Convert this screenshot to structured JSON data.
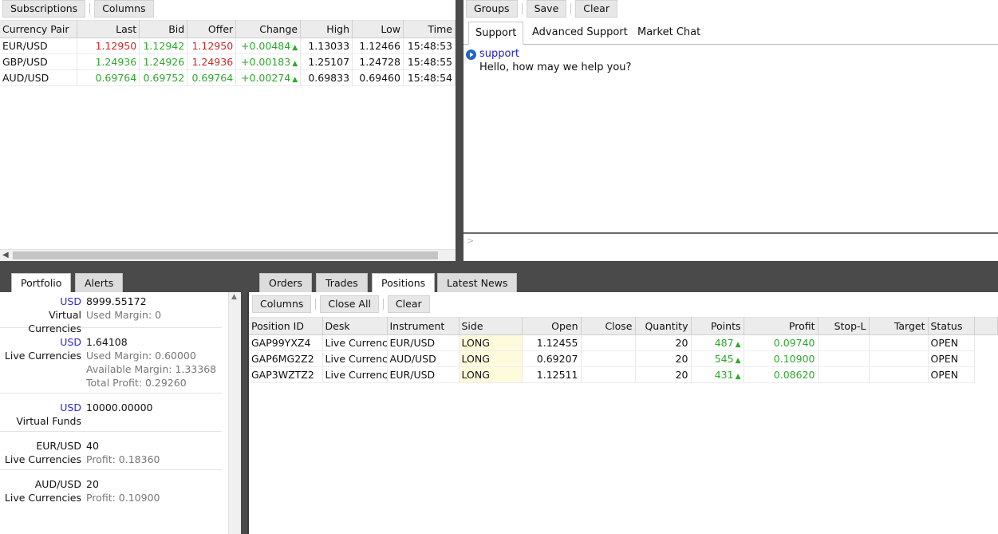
{
  "rates": {
    "toolbar": {
      "subscriptions": "Subscriptions",
      "columns": "Columns"
    },
    "headers": [
      "Currency Pair",
      "Last",
      "Bid",
      "Offer",
      "Change",
      "High",
      "Low",
      "Time"
    ],
    "rows": [
      {
        "pair": "EUR/USD",
        "last": "1.12950",
        "bid": "1.12942",
        "offer": "1.12950",
        "change": "+0.00484",
        "high": "1.13033",
        "low": "1.12466",
        "time": "15:48:53"
      },
      {
        "pair": "GBP/USD",
        "last": "1.24936",
        "bid": "1.24926",
        "offer": "1.24936",
        "change": "+0.00183",
        "high": "1.25107",
        "low": "1.24728",
        "time": "15:48:55"
      },
      {
        "pair": "AUD/USD",
        "last": "0.69764",
        "bid": "0.69752",
        "offer": "0.69764",
        "change": "+0.00274",
        "high": "0.69833",
        "low": "0.69460",
        "time": "15:48:54"
      }
    ]
  },
  "chat": {
    "toolbar": {
      "groups": "Groups",
      "save": "Save",
      "clear": "Clear"
    },
    "tabs": [
      "Support",
      "Advanced Support",
      "Market Chat"
    ],
    "message": {
      "sender": "support",
      "text": "Hello, how may we help you?"
    },
    "input_hint": ">"
  },
  "portfolio": {
    "tabs": [
      "Portfolio",
      "Alerts"
    ],
    "blocks": [
      {
        "rows": [
          {
            "label": "USD",
            "value": "8999.55172",
            "label_blue": true
          },
          {
            "label": "Virtual Currencies",
            "value": "Used Margin:  0",
            "grey": true
          }
        ]
      },
      {
        "rows": [
          {
            "label": "USD",
            "value": "1.64108",
            "label_blue": true
          },
          {
            "label": "Live Currencies",
            "value": "Used Margin:  0.60000",
            "grey": true
          },
          {
            "label": "",
            "value": "Available Margin:  1.33368",
            "grey": true
          },
          {
            "label": "",
            "value": "Total Profit:  0.29260",
            "grey": true
          }
        ]
      },
      {
        "rows": [
          {
            "label": "USD",
            "value": "10000.00000",
            "label_blue": true
          },
          {
            "label": "Virtual Funds",
            "value": ""
          }
        ]
      },
      {
        "rows": [
          {
            "label": "EUR/USD",
            "value": "40"
          },
          {
            "label": "Live Currencies",
            "value": "Profit:  0.18360",
            "grey": true
          }
        ]
      },
      {
        "rows": [
          {
            "label": "AUD/USD",
            "value": "20"
          },
          {
            "label": "Live Currencies",
            "value": "Profit:  0.10900",
            "grey": true
          }
        ]
      }
    ]
  },
  "positions": {
    "tabs": [
      "Orders",
      "Trades",
      "Positions",
      "Latest News"
    ],
    "toolbar": {
      "columns": "Columns",
      "close_all": "Close All",
      "clear": "Clear"
    },
    "headers": [
      "Position ID",
      "Desk",
      "Instrument",
      "Side",
      "Open",
      "Close",
      "Quantity",
      "Points",
      "Profit",
      "Stop-L",
      "Target",
      "Status"
    ],
    "rows": [
      {
        "id": "GAP99YXZ4",
        "desk": "Live Currencies",
        "instrument": "EUR/USD",
        "side": "LONG",
        "open": "1.12455",
        "close": "",
        "quantity": "20",
        "points": "487",
        "profit": "0.09740",
        "stop": "",
        "target": "",
        "status": "OPEN"
      },
      {
        "id": "GAP6MG2Z2",
        "desk": "Live Currencies",
        "instrument": "AUD/USD",
        "side": "LONG",
        "open": "0.69207",
        "close": "",
        "quantity": "20",
        "points": "545",
        "profit": "0.10900",
        "stop": "",
        "target": "",
        "status": "OPEN"
      },
      {
        "id": "GAP3WZTZ2",
        "desk": "Live Currencies",
        "instrument": "EUR/USD",
        "side": "LONG",
        "open": "1.12511",
        "close": "",
        "quantity": "20",
        "points": "431",
        "profit": "0.08620",
        "stop": "",
        "target": "",
        "status": "OPEN"
      }
    ]
  }
}
